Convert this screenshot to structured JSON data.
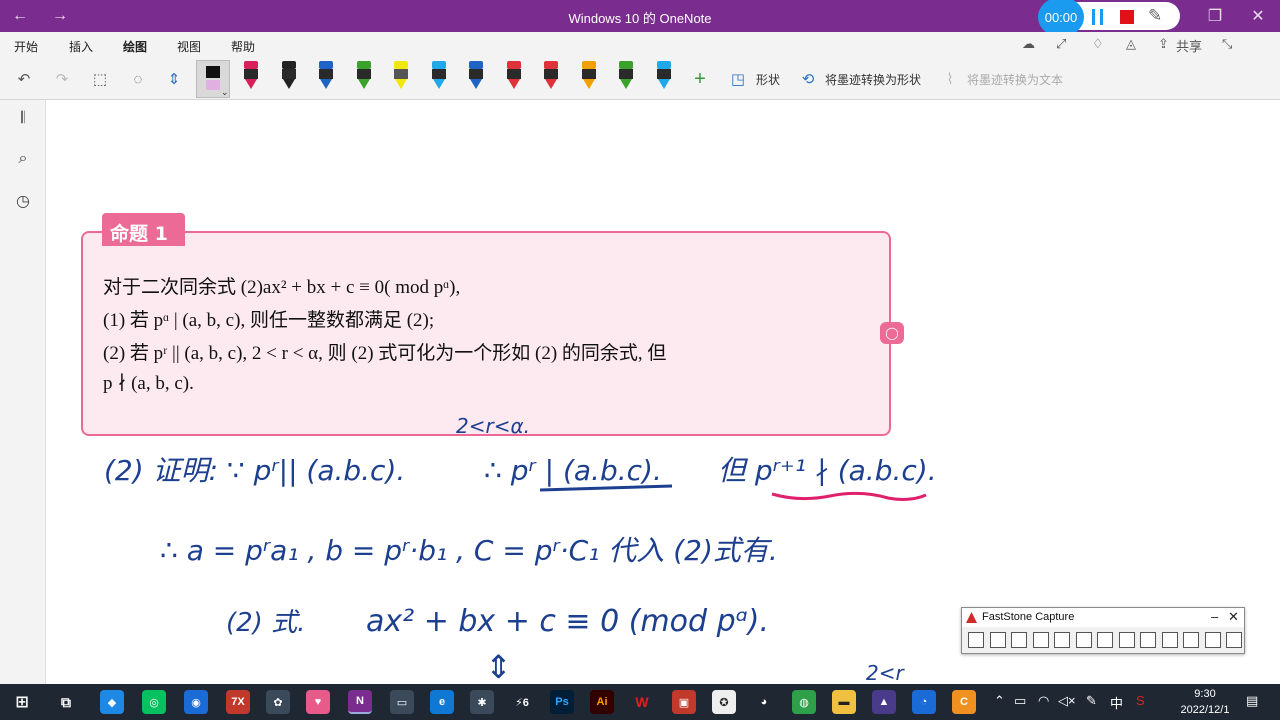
{
  "window": {
    "title": "Windows 10 的 OneNote",
    "back_icon": "arrow-left-icon",
    "forward_icon": "arrow-right-icon"
  },
  "recorder": {
    "time": "00:00"
  },
  "menu": {
    "items": [
      "开始",
      "插入",
      "绘图",
      "视图",
      "帮助"
    ],
    "active": "绘图",
    "share": "共享"
  },
  "ribbon": {
    "pens": [
      "#d8205a",
      "#222222",
      "#1f63c4",
      "#3aa12a",
      "#f2e70a",
      "#20a8e8",
      "#1f63c4",
      "#e0303a",
      "#e0303a",
      "#f0a000",
      "#3aa12a",
      "#20a8e8"
    ],
    "shape_label": "形状",
    "ink_to_shape_label": "将墨迹转换为形状",
    "ink_to_text_label": "将墨迹转换为文本"
  },
  "proposition": {
    "tab": "命题 1",
    "lines": [
      "对于二次同余式 (2)ax² + bx + c ≡ 0(  mod pᵅ),",
      "(1) 若 pᵅ | (a, b, c), 则任一整数都满足 (2);",
      "(2) 若 pʳ || (a, b, c), 2 < r < α, 则 (2) 式可化为一个形如 (2) 的同余式, 但",
      "p ∤ (a, b, c)."
    ]
  },
  "ink": {
    "annot": "2<r<α.",
    "line1a": "(2) 证明: ∵ pʳ|| (a.b.c).",
    "line1b": "∴ pʳ | (a.b.c).",
    "line1c": "但 pʳ⁺¹ ∤ (a.b.c).",
    "line2": "∴ a = pʳa₁ , b = pʳ·b₁ , C = pʳ·C₁ 代入 (2)式有.",
    "line3a": "(2) 式.",
    "line3b": "ax² + bx + c ≡ 0  (mod pᵅ).",
    "corner": "2<r",
    "arrow": "⇕"
  },
  "faststone": {
    "title": "FastStone Capture"
  },
  "taskbar": {
    "time": "9:30",
    "date": "2022/12/1",
    "ime": "中"
  },
  "icons": {
    "notebooks": "notebooks-icon",
    "search": "search-icon",
    "recent": "clock-icon"
  }
}
